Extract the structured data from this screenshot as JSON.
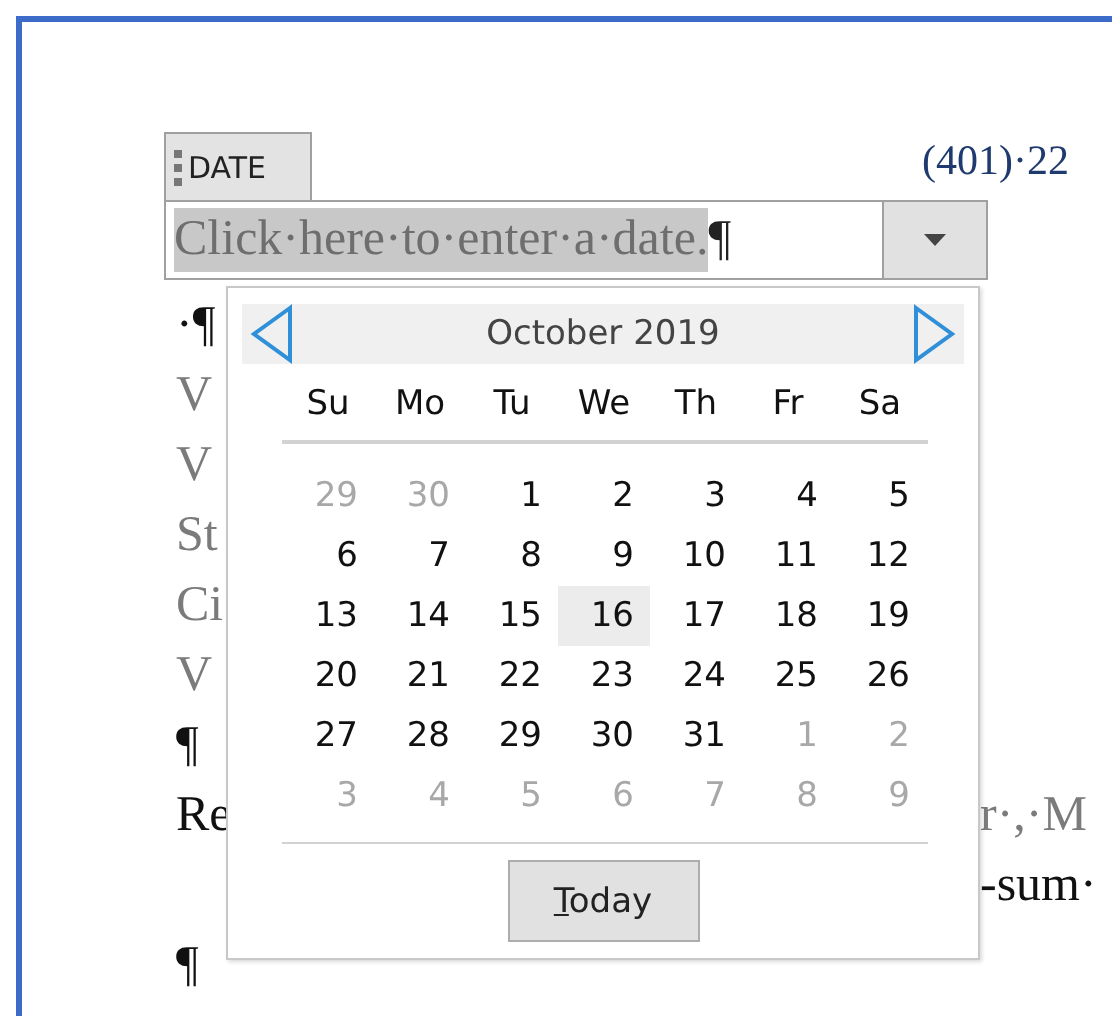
{
  "document": {
    "phone": "(401)·22",
    "lines": [
      {
        "left": "·¶",
        "left_greyed": false
      },
      {
        "left": "V",
        "left_greyed": true
      },
      {
        "left": "V",
        "left_greyed": true
      },
      {
        "left": "St",
        "left_greyed": true
      },
      {
        "left": "Ci",
        "left_greyed": true
      },
      {
        "left": "V",
        "left_greyed": true
      },
      {
        "left": "¶",
        "left_greyed": false
      },
      {
        "left": "Re",
        "left_greyed": false,
        "right": "r·,·M",
        "right_greyed": true
      },
      {
        "right": "-sum·",
        "right_greyed": false
      },
      {
        "left": "¶",
        "left_greyed": false
      }
    ]
  },
  "content_control": {
    "tag": "DATE",
    "placeholder": "Click·here·to·enter·a·date.",
    "pilcrow": "¶"
  },
  "calendar": {
    "month": "October 2019",
    "weekdays": [
      "Su",
      "Mo",
      "Tu",
      "We",
      "Th",
      "Fr",
      "Sa"
    ],
    "weeks": [
      [
        {
          "day": "29",
          "in_month": false,
          "selected": false
        },
        {
          "day": "30",
          "in_month": false,
          "selected": false
        },
        {
          "day": "1",
          "in_month": true,
          "selected": false
        },
        {
          "day": "2",
          "in_month": true,
          "selected": false
        },
        {
          "day": "3",
          "in_month": true,
          "selected": false
        },
        {
          "day": "4",
          "in_month": true,
          "selected": false
        },
        {
          "day": "5",
          "in_month": true,
          "selected": false
        }
      ],
      [
        {
          "day": "6",
          "in_month": true,
          "selected": false
        },
        {
          "day": "7",
          "in_month": true,
          "selected": false
        },
        {
          "day": "8",
          "in_month": true,
          "selected": false
        },
        {
          "day": "9",
          "in_month": true,
          "selected": false
        },
        {
          "day": "10",
          "in_month": true,
          "selected": false
        },
        {
          "day": "11",
          "in_month": true,
          "selected": false
        },
        {
          "day": "12",
          "in_month": true,
          "selected": false
        }
      ],
      [
        {
          "day": "13",
          "in_month": true,
          "selected": false
        },
        {
          "day": "14",
          "in_month": true,
          "selected": false
        },
        {
          "day": "15",
          "in_month": true,
          "selected": false
        },
        {
          "day": "16",
          "in_month": true,
          "selected": true
        },
        {
          "day": "17",
          "in_month": true,
          "selected": false
        },
        {
          "day": "18",
          "in_month": true,
          "selected": false
        },
        {
          "day": "19",
          "in_month": true,
          "selected": false
        }
      ],
      [
        {
          "day": "20",
          "in_month": true,
          "selected": false
        },
        {
          "day": "21",
          "in_month": true,
          "selected": false
        },
        {
          "day": "22",
          "in_month": true,
          "selected": false
        },
        {
          "day": "23",
          "in_month": true,
          "selected": false
        },
        {
          "day": "24",
          "in_month": true,
          "selected": false
        },
        {
          "day": "25",
          "in_month": true,
          "selected": false
        },
        {
          "day": "26",
          "in_month": true,
          "selected": false
        }
      ],
      [
        {
          "day": "27",
          "in_month": true,
          "selected": false
        },
        {
          "day": "28",
          "in_month": true,
          "selected": false
        },
        {
          "day": "29",
          "in_month": true,
          "selected": false
        },
        {
          "day": "30",
          "in_month": true,
          "selected": false
        },
        {
          "day": "31",
          "in_month": true,
          "selected": false
        },
        {
          "day": "1",
          "in_month": false,
          "selected": false
        },
        {
          "day": "2",
          "in_month": false,
          "selected": false
        }
      ],
      [
        {
          "day": "3",
          "in_month": false,
          "selected": false
        },
        {
          "day": "4",
          "in_month": false,
          "selected": false
        },
        {
          "day": "5",
          "in_month": false,
          "selected": false
        },
        {
          "day": "6",
          "in_month": false,
          "selected": false
        },
        {
          "day": "7",
          "in_month": false,
          "selected": false
        },
        {
          "day": "8",
          "in_month": false,
          "selected": false
        },
        {
          "day": "9",
          "in_month": false,
          "selected": false
        }
      ]
    ],
    "today_button": {
      "access_key": "T",
      "rest": "oday"
    }
  }
}
